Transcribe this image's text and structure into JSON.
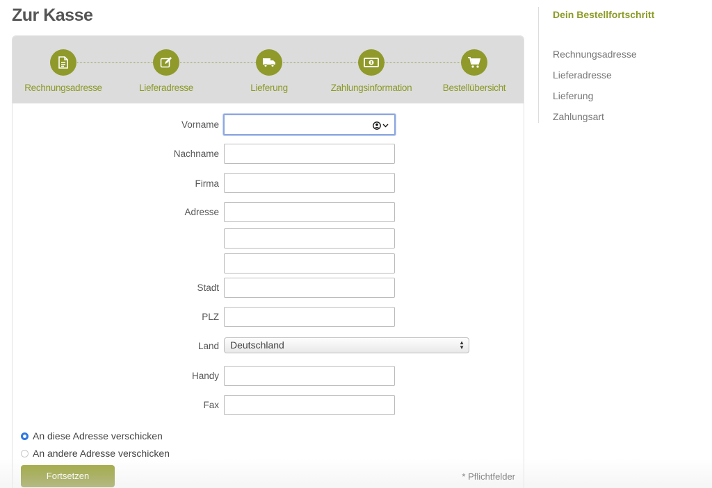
{
  "page": {
    "title": "Zur Kasse"
  },
  "steps": [
    {
      "label": "Rechnungsadresse",
      "icon": "document-icon"
    },
    {
      "label": "Lieferadresse",
      "icon": "edit-icon"
    },
    {
      "label": "Lieferung",
      "icon": "truck-icon"
    },
    {
      "label": "Zahlungsinformation",
      "icon": "money-icon"
    },
    {
      "label": "Bestellübersicht",
      "icon": "cart-icon"
    }
  ],
  "form": {
    "vorname": {
      "label": "Vorname",
      "value": ""
    },
    "nachname": {
      "label": "Nachname",
      "value": ""
    },
    "firma": {
      "label": "Firma",
      "value": ""
    },
    "adresse": {
      "label": "Adresse",
      "line1": "",
      "line2": "",
      "line3": ""
    },
    "stadt": {
      "label": "Stadt",
      "value": ""
    },
    "plz": {
      "label": "PLZ",
      "value": ""
    },
    "land": {
      "label": "Land",
      "value": "Deutschland"
    },
    "handy": {
      "label": "Handy",
      "value": ""
    },
    "fax": {
      "label": "Fax",
      "value": ""
    }
  },
  "shipping_options": [
    {
      "label": "An diese Adresse verschicken",
      "selected": true
    },
    {
      "label": "An andere Adresse verschicken",
      "selected": false
    }
  ],
  "actions": {
    "continue_label": "Fortsetzen",
    "required_note": "* Pflichtfelder"
  },
  "sidebar": {
    "title": "Dein Bestellfortschritt",
    "items": [
      "Rechnungsadresse",
      "Lieferadresse",
      "Lieferung",
      "Zahlungsart"
    ]
  },
  "colors": {
    "accent": "#8c9a25",
    "focus": "#8fa8e0",
    "radio": "#2f78e2"
  }
}
